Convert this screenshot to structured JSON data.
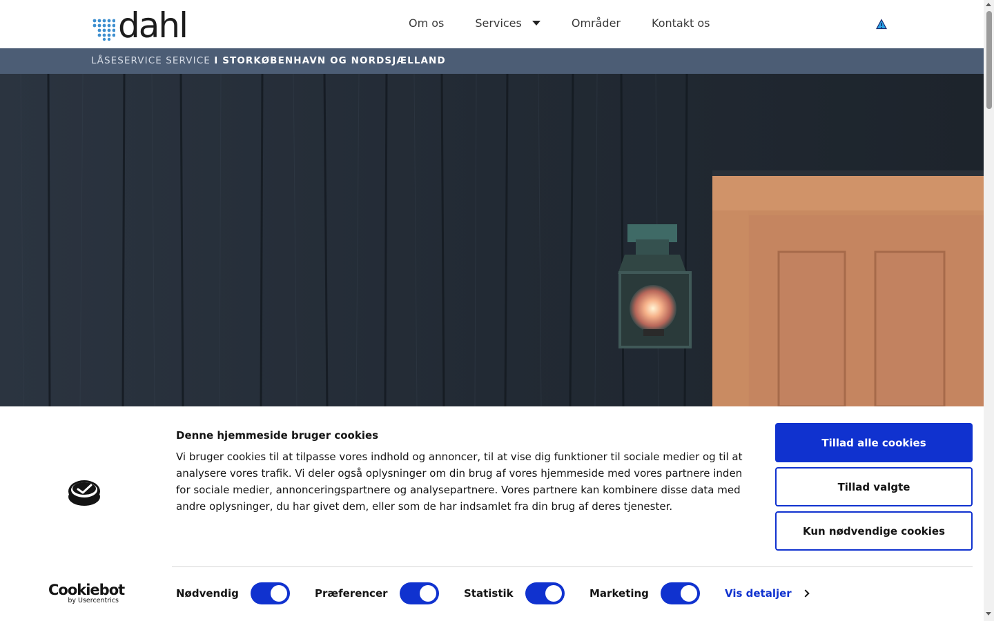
{
  "header": {
    "logo_text": "dahl",
    "nav": [
      {
        "label": "Om os"
      },
      {
        "label": "Services"
      },
      {
        "label": "Områder"
      },
      {
        "label": "Kontakt os"
      }
    ],
    "warning_icon": "warning-triangle-icon"
  },
  "tagline": {
    "light": "LÅSESERVICE SERVICE",
    "bold": "I STORKØBENHAVN OG NORDSJÆLLAND"
  },
  "cookie_banner": {
    "heading": "Denne hjemmeside bruger cookies",
    "body": "Vi bruger cookies til at tilpasse vores indhold og annoncer, til at vise dig funktioner til sociale medier og til at analysere vores trafik. Vi deler også oplysninger om din brug af vores hjemmeside med vores partnere inden for sociale medier, annonceringspartnere og analysepartnere. Vores partnere kan kombinere disse data med andre oplysninger, du har givet dem, eller som de har indsamlet fra din brug af deres tjenester.",
    "buttons": {
      "allow_all": "Tillad alle cookies",
      "allow_selected": "Tillad valgte",
      "necessary_only": "Kun nødvendige cookies"
    },
    "toggles": [
      {
        "label": "Nødvendig",
        "checked": true
      },
      {
        "label": "Præferencer",
        "checked": true
      },
      {
        "label": "Statistik",
        "checked": true
      },
      {
        "label": "Marketing",
        "checked": true
      }
    ],
    "details_link": "Vis detaljer",
    "brand_title": "Cookiebot",
    "brand_sub": "by Usercentrics"
  },
  "colors": {
    "accent": "#1032cf",
    "tagline_bg": "#4c5d75",
    "logo_dots": "#3d8fcf"
  }
}
